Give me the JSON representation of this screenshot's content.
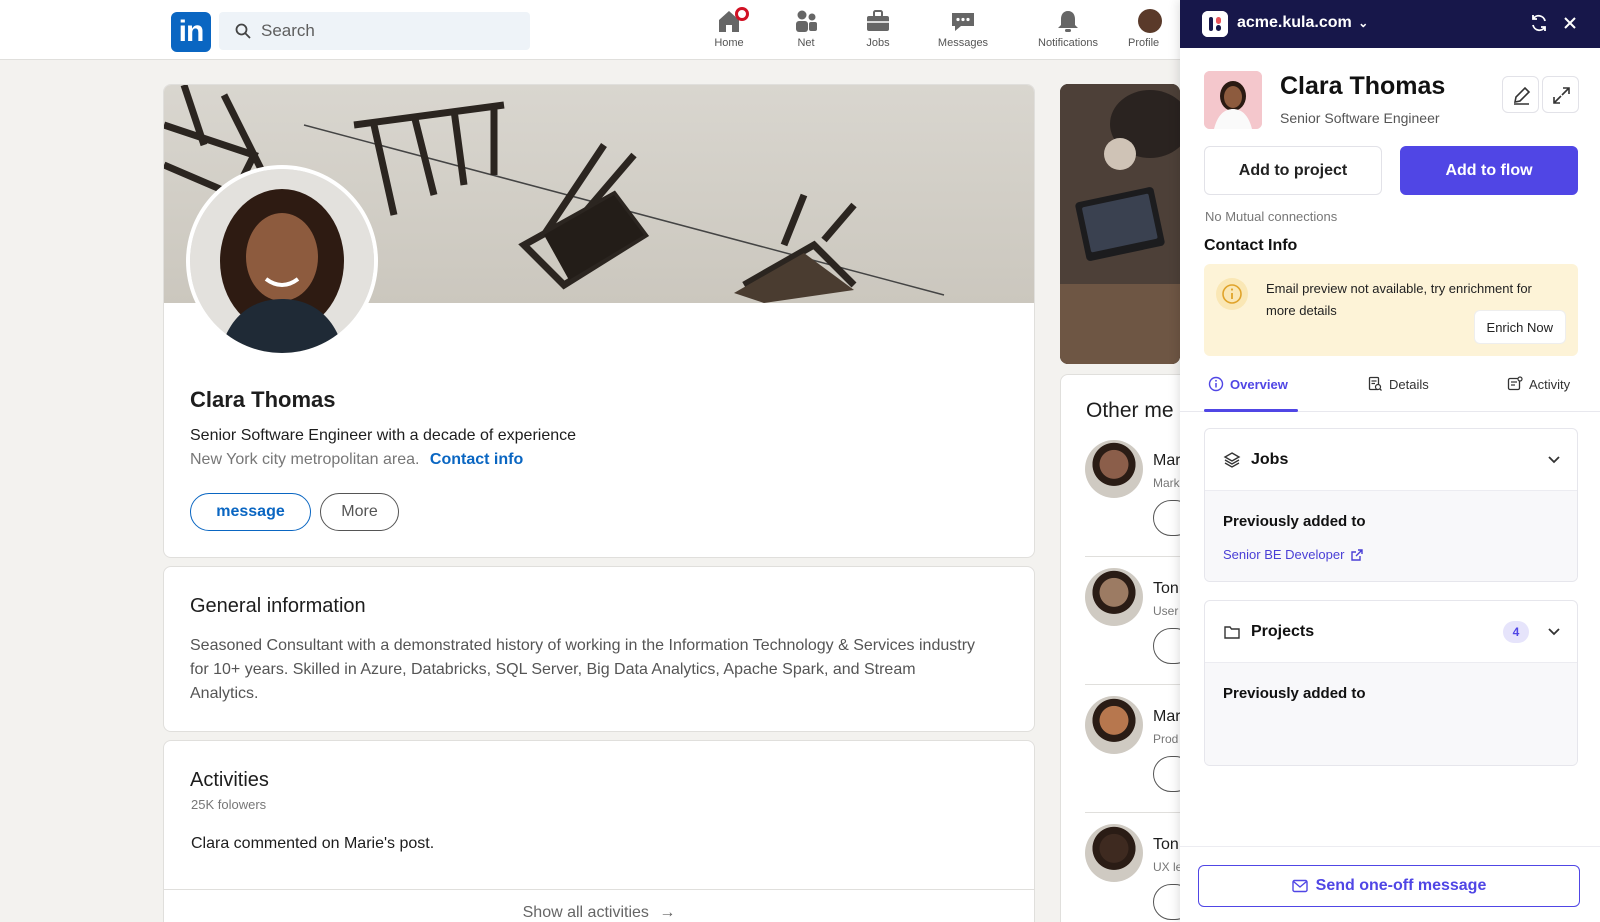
{
  "linkedin": {
    "logo_text": "in",
    "search_placeholder": "Search",
    "nav": [
      {
        "label": "Home"
      },
      {
        "label": "Net"
      },
      {
        "label": "Jobs"
      },
      {
        "label": "Messages"
      },
      {
        "label": "Notifications"
      },
      {
        "label": "Profile"
      }
    ]
  },
  "profile": {
    "name": "Clara Thomas",
    "headline": "Senior Software Engineer with a decade of experience",
    "location": "New York city metropolitan area.",
    "contact_link": "Contact info",
    "message_btn": "message",
    "more_btn": "More"
  },
  "general": {
    "title": "General information",
    "body": "Seasoned Consultant with a demonstrated history of working in the Information Technology & Services industry for 10+ years. Skilled in Azure, Databricks, SQL Server, Big Data Analytics, Apache Spark, and Stream Analytics."
  },
  "activities": {
    "title": "Activities",
    "followers": "25K folowers",
    "item": "Clara commented on Marie's post.",
    "show_all": "Show all activities"
  },
  "side": {
    "other_title": "Other me",
    "people": [
      {
        "name": "Mar",
        "sub": "Mark",
        "color": "#8b5e4a"
      },
      {
        "name": "Ton",
        "sub": "User",
        "color": "#9c7b63"
      },
      {
        "name": "Mar",
        "sub": "Prod",
        "color": "#b7774e"
      },
      {
        "name": "Ton",
        "sub": "UX le",
        "color": "#3e2a20"
      }
    ]
  },
  "kula": {
    "domain": "acme.kula.com",
    "name": "Clara Thomas",
    "title": "Senior Software Engineer",
    "add_project": "Add to project",
    "add_flow": "Add to flow",
    "mutual": "No Mutual connections",
    "contact_title": "Contact Info",
    "alert_text": "Email preview not available, try enrichment for more details",
    "enrich_btn": "Enrich Now",
    "tabs": [
      {
        "label": "Overview"
      },
      {
        "label": "Details"
      },
      {
        "label": "Activity"
      }
    ],
    "jobs": {
      "title": "Jobs",
      "prev_label": "Previously added to",
      "link": "Senior BE Developer"
    },
    "projects": {
      "title": "Projects",
      "count": "4",
      "prev_label": "Previously added to"
    },
    "send_btn": "Send one-off message",
    "colors": {
      "accent": "#5046e5",
      "header": "#17174a",
      "alert_bg": "#fdf3d7"
    }
  }
}
